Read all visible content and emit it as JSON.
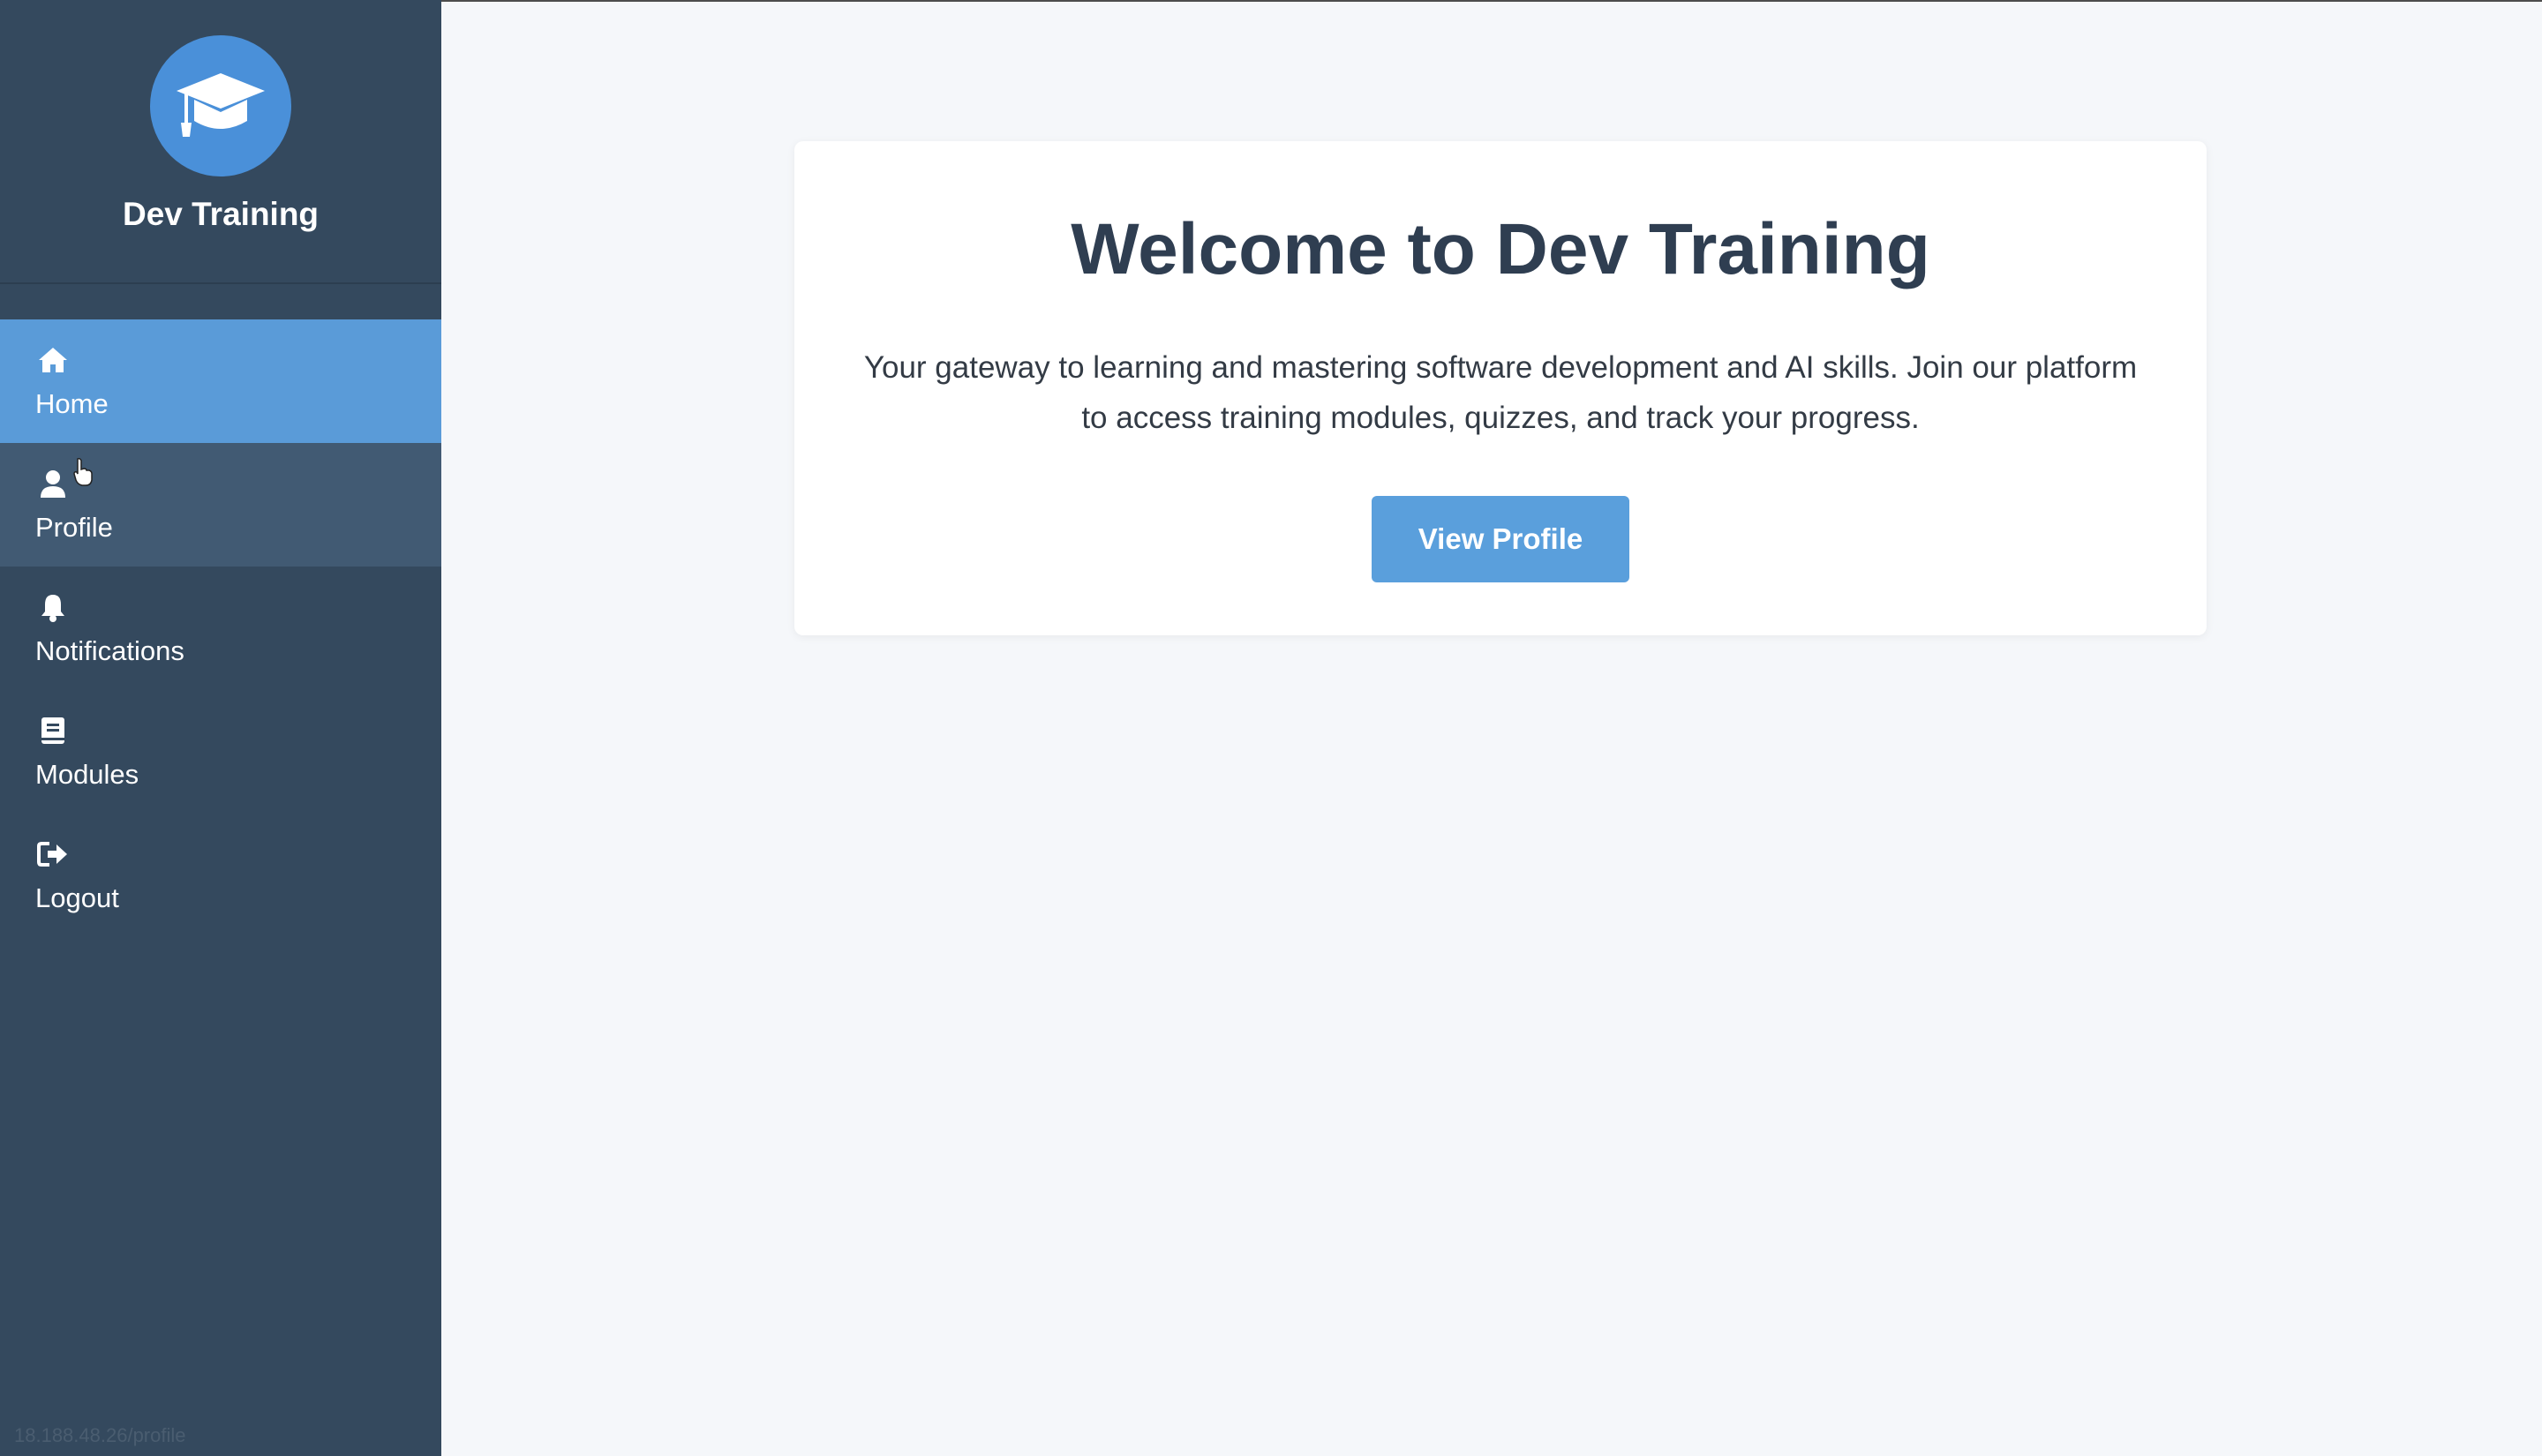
{
  "app": {
    "brand_name": "Dev Training",
    "brand_icon": "graduation-cap-icon"
  },
  "sidebar": {
    "items": [
      {
        "label": "Home",
        "icon": "home-icon",
        "state": "active"
      },
      {
        "label": "Profile",
        "icon": "user-icon",
        "state": "hover"
      },
      {
        "label": "Notifications",
        "icon": "bell-icon",
        "state": "normal"
      },
      {
        "label": "Modules",
        "icon": "book-icon",
        "state": "normal"
      },
      {
        "label": "Logout",
        "icon": "logout-icon",
        "state": "normal"
      }
    ],
    "status_url": "18.188.48.26/profile"
  },
  "main": {
    "title": "Welcome to Dev Training",
    "description": "Your gateway to learning and mastering software development and AI skills. Join our platform to access training modules, quizzes, and track your progress.",
    "cta_label": "View Profile"
  },
  "colors": {
    "sidebar_bg": "#34495e",
    "active_item_bg": "#5a9bd8",
    "hover_item_bg": "#415a73",
    "accent": "#4a90d9",
    "main_bg": "#f5f7fa",
    "title_text": "#2f3e51"
  }
}
